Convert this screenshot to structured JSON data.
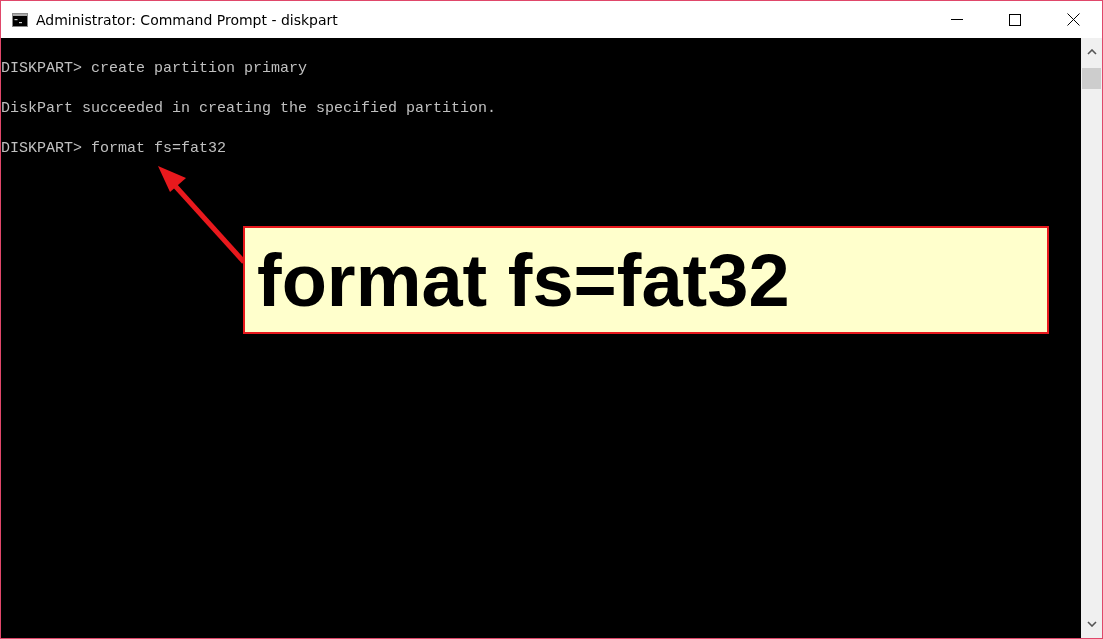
{
  "window": {
    "title": "Administrator: Command Prompt - diskpart"
  },
  "console_lines": [
    "DISKPART> create partition primary",
    "DiskPart succeeded in creating the specified partition.",
    "DISKPART> format fs=fat32"
  ],
  "callout": {
    "text": "format fs=fat32"
  }
}
